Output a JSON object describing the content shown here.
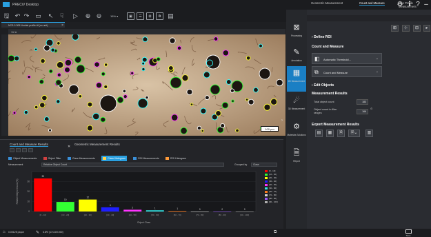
{
  "app": {
    "title": "PRECiV Desktop"
  },
  "toolbar": {
    "zoom": "16% ▾"
  },
  "document": {
    "tab_title": "NCS-0 305 Nodule profile.tif (no unit)",
    "image_toolbar_label": "1X ▾",
    "scale_bar": "100 µm"
  },
  "nav": {
    "items": [
      {
        "label": "Processing",
        "icon": "⊠"
      },
      {
        "label": "Annotation",
        "icon": "✎"
      },
      {
        "label": "2D Measurement",
        "icon": "▦"
      },
      {
        "label": "3D Measurement",
        "icon": "☄"
      },
      {
        "label": "Materials Solutions",
        "icon": "⚙"
      },
      {
        "label": "Report",
        "icon": "🗎"
      }
    ]
  },
  "right_panel": {
    "tabs": [
      "Geometric Measurement",
      "Count and Measure",
      "Line Profile Measurement"
    ],
    "define_roi": "Define ROI",
    "count_measure_heading": "Count and Measure",
    "threshold_field": "Automatic Threshold...",
    "count_field": "Count and Measure",
    "edit_objects": "Edit Objects",
    "results_heading": "Measurement Results",
    "total_label": "Total object count",
    "total_value": "183",
    "filter_label": "Object count in filter ranges",
    "filter_value": "166",
    "export_heading": "Export Measurement Results"
  },
  "results": {
    "tabs": [
      "Count and Measure Results",
      "Geometric Measurement Results"
    ],
    "subtabs": [
      "Object Measurements",
      "Object Filter",
      "Class Measurements",
      "Class Histogram",
      "ROI Measurements",
      "ROI Histogram"
    ],
    "measurement_label": "Measurement",
    "measurement_value": "Relative Object Count",
    "grouped_by_label": "Grouped by",
    "grouped_by_value": "Class"
  },
  "status": {
    "left": "0.00125 px/µm",
    "middle": "6.8% (171.8/0.000)"
  },
  "save_label": "Save",
  "chart_data": {
    "type": "bar",
    "title": "",
    "xlabel": "Object Class",
    "ylabel": "Relative Object Count (%)",
    "ylim": [
      0,
      40
    ],
    "yticks": [
      0,
      10,
      20,
      30
    ],
    "categories": [
      "[0 - 10]",
      "[10 - 20]",
      "[20 - 30]",
      "[30 - 40]",
      "[40 - 50]",
      "[50 - 60]",
      "[60 - 70]",
      "[70 - 80]",
      "[80 - 90]",
      "[90 - 100]"
    ],
    "values": [
      33.1,
      9.6,
      12.0,
      4.2,
      1.8,
      1.2,
      0.6,
      0.0,
      0.0,
      0.0
    ],
    "data_labels": [
      "33",
      "10",
      "12",
      "4",
      "2",
      "1",
      "1",
      "0",
      "0",
      "0"
    ],
    "colors": [
      "#ff0000",
      "#33ff33",
      "#ffff00",
      "#1f1fff",
      "#ff33ff",
      "#33e5e5",
      "#ff7a1a",
      "#d9d9d9",
      "#9b59ff",
      "#b0b0b0"
    ],
    "legend": [
      "[0 - 10]",
      "[10 - 20]",
      "[20 - 30]",
      "[30 - 40]",
      "[40 - 50]",
      "[50 - 60]",
      "[60 - 70]",
      "[70 - 80]",
      "[80 - 90]",
      "[90 - 100]"
    ],
    "legend_position": "right"
  }
}
